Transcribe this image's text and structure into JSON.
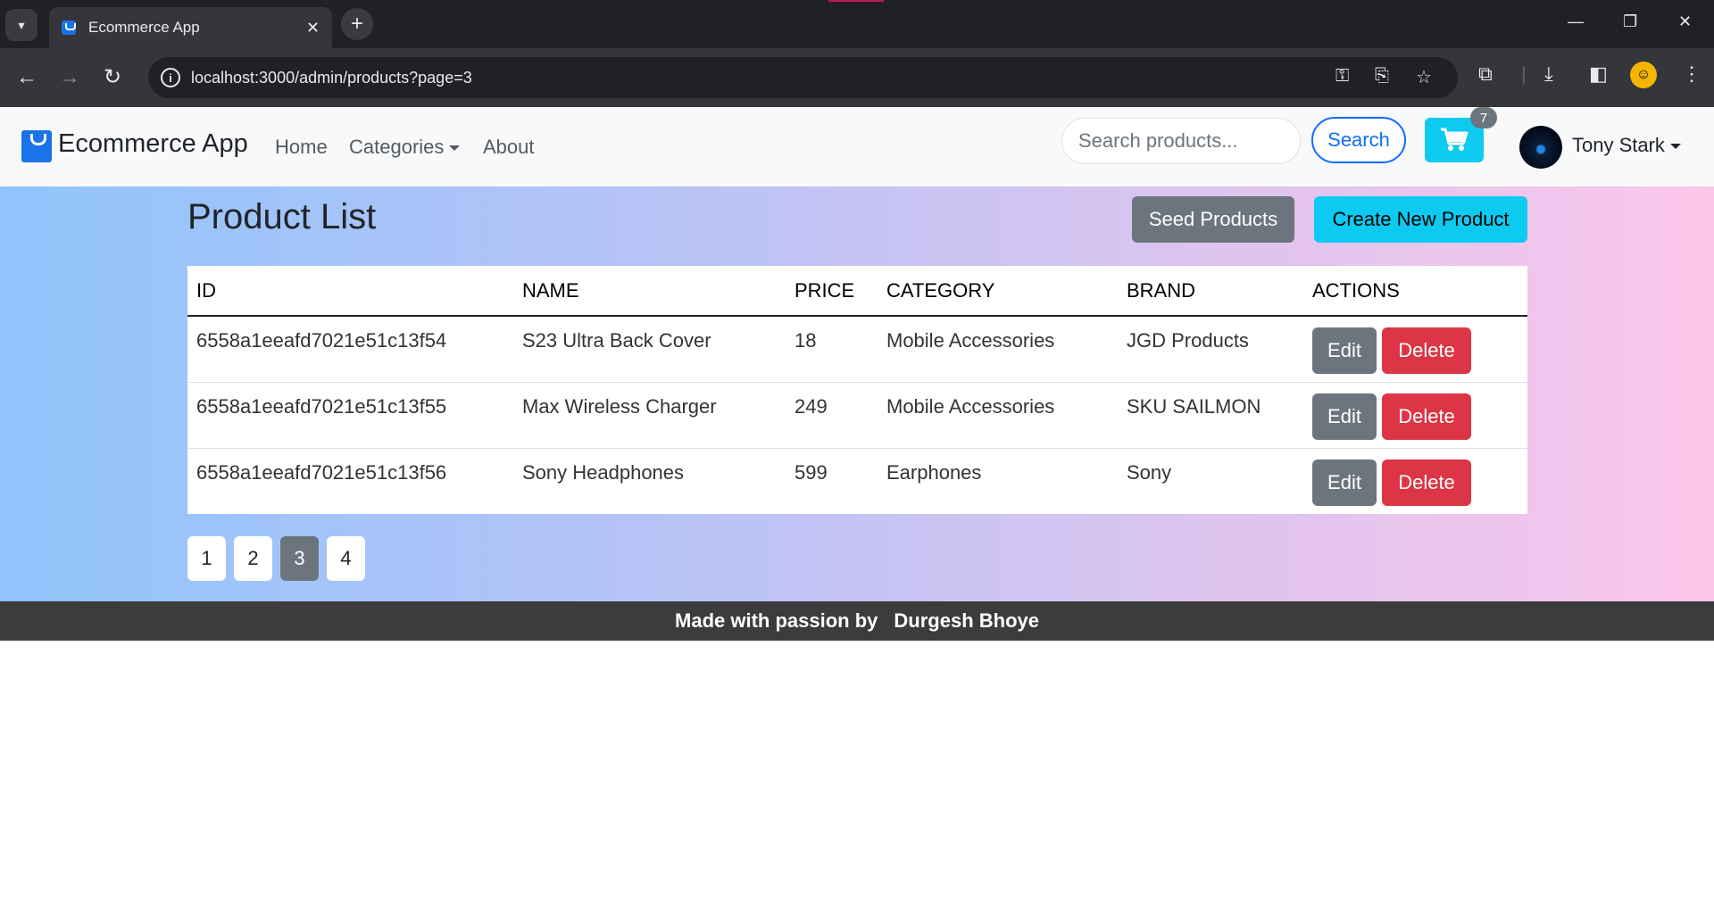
{
  "browser": {
    "tab_title": "Ecommerce App",
    "url": "localhost:3000/admin/products?page=3"
  },
  "navbar": {
    "brand": "Ecommerce App",
    "links": [
      "Home",
      "Categories",
      "About"
    ],
    "search_placeholder": "Search products...",
    "search_label": "Search",
    "cart_count": "7",
    "user_name": "Tony Stark"
  },
  "main": {
    "title": "Product List",
    "seed_label": "Seed Products",
    "create_label": "Create New Product",
    "columns": [
      "ID",
      "NAME",
      "PRICE",
      "CATEGORY",
      "BRAND",
      "ACTIONS"
    ],
    "rows": [
      {
        "id": "6558a1eeafd7021e51c13f54",
        "name": "S23 Ultra Back Cover",
        "price": "18",
        "category": "Mobile Accessories",
        "brand": "JGD Products"
      },
      {
        "id": "6558a1eeafd7021e51c13f55",
        "name": "Max Wireless Charger",
        "price": "249",
        "category": "Mobile Accessories",
        "brand": "SKU SAILMON"
      },
      {
        "id": "6558a1eeafd7021e51c13f56",
        "name": "Sony Headphones",
        "price": "599",
        "category": "Earphones",
        "brand": "Sony"
      }
    ],
    "edit_label": "Edit",
    "delete_label": "Delete",
    "pages": [
      "1",
      "2",
      "3",
      "4"
    ],
    "active_page": "3"
  },
  "footer": {
    "text": "Made with passion by",
    "author": "Durgesh Bhoye"
  },
  "colors": {
    "primary": "#0d6efd",
    "info": "#0dcaf0",
    "secondary": "#6c757d",
    "danger": "#dc3545"
  }
}
